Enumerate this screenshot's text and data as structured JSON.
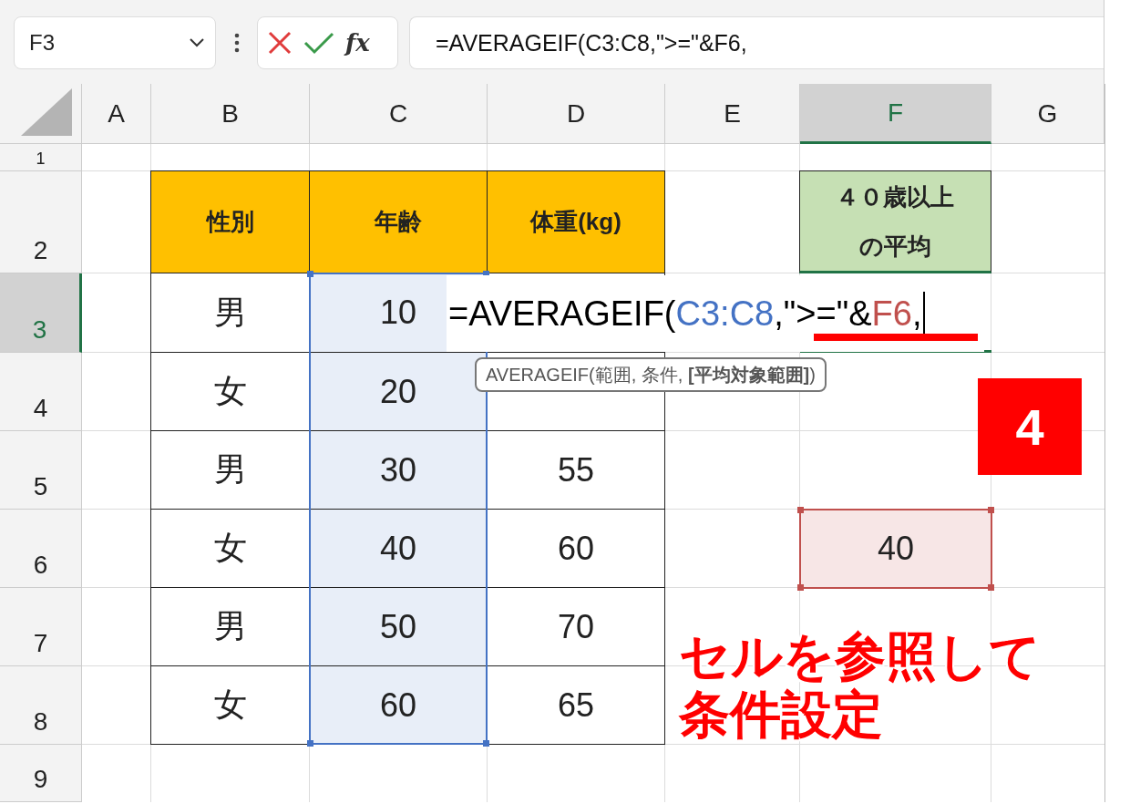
{
  "formula_bar": {
    "name_box": "F3",
    "fx_label": "fx",
    "formula": "=AVERAGEIF(C3:C8,\">=\"&F6,"
  },
  "columns": [
    {
      "label": "A",
      "selected": false
    },
    {
      "label": "B",
      "selected": false
    },
    {
      "label": "C",
      "selected": false
    },
    {
      "label": "D",
      "selected": false
    },
    {
      "label": "E",
      "selected": false
    },
    {
      "label": "F",
      "selected": true
    },
    {
      "label": "G",
      "selected": false
    }
  ],
  "rows": [
    {
      "label": "1",
      "selected": false,
      "cells": [
        {
          "kind": "empty"
        },
        {
          "kind": "empty"
        },
        {
          "kind": "empty"
        },
        {
          "kind": "empty"
        },
        {
          "kind": "empty"
        },
        {
          "kind": "empty"
        },
        {
          "kind": "empty"
        }
      ]
    },
    {
      "label": "2",
      "selected": false,
      "cells": [
        {
          "kind": "empty"
        },
        {
          "kind": "header",
          "value": "性別"
        },
        {
          "kind": "header",
          "value": "年齢"
        },
        {
          "kind": "header",
          "value": "体重(kg)"
        },
        {
          "kind": "empty"
        },
        {
          "kind": "label",
          "value": "４０歳以上の平均"
        },
        {
          "kind": "empty"
        }
      ]
    },
    {
      "label": "3",
      "selected": true,
      "cells": [
        {
          "kind": "empty"
        },
        {
          "kind": "data",
          "value": "男"
        },
        {
          "kind": "range",
          "value": "10"
        },
        {
          "kind": "data"
        },
        {
          "kind": "empty"
        },
        {
          "kind": "active"
        },
        {
          "kind": "empty"
        }
      ]
    },
    {
      "label": "4",
      "selected": false,
      "cells": [
        {
          "kind": "empty"
        },
        {
          "kind": "data",
          "value": "女"
        },
        {
          "kind": "range",
          "value": "20"
        },
        {
          "kind": "data"
        },
        {
          "kind": "empty"
        },
        {
          "kind": "empty"
        },
        {
          "kind": "empty"
        }
      ]
    },
    {
      "label": "5",
      "selected": false,
      "cells": [
        {
          "kind": "empty"
        },
        {
          "kind": "data",
          "value": "男"
        },
        {
          "kind": "range",
          "value": "30"
        },
        {
          "kind": "data",
          "value": "55"
        },
        {
          "kind": "empty"
        },
        {
          "kind": "empty"
        },
        {
          "kind": "empty"
        }
      ]
    },
    {
      "label": "6",
      "selected": false,
      "cells": [
        {
          "kind": "empty"
        },
        {
          "kind": "data",
          "value": "女"
        },
        {
          "kind": "range",
          "value": "40"
        },
        {
          "kind": "data",
          "value": "60"
        },
        {
          "kind": "empty"
        },
        {
          "kind": "ref",
          "value": "40"
        },
        {
          "kind": "empty"
        }
      ]
    },
    {
      "label": "7",
      "selected": false,
      "cells": [
        {
          "kind": "empty"
        },
        {
          "kind": "data",
          "value": "男"
        },
        {
          "kind": "range",
          "value": "50"
        },
        {
          "kind": "data",
          "value": "70"
        },
        {
          "kind": "empty"
        },
        {
          "kind": "empty"
        },
        {
          "kind": "empty"
        }
      ]
    },
    {
      "label": "8",
      "selected": false,
      "cells": [
        {
          "kind": "empty"
        },
        {
          "kind": "data",
          "value": "女"
        },
        {
          "kind": "range",
          "value": "60"
        },
        {
          "kind": "data",
          "value": "65"
        },
        {
          "kind": "empty"
        },
        {
          "kind": "empty"
        },
        {
          "kind": "empty"
        }
      ]
    },
    {
      "label": "9",
      "selected": false,
      "cells": [
        {
          "kind": "empty"
        },
        {
          "kind": "empty"
        },
        {
          "kind": "empty"
        },
        {
          "kind": "empty"
        },
        {
          "kind": "empty"
        },
        {
          "kind": "empty"
        },
        {
          "kind": "empty"
        }
      ]
    }
  ],
  "editing_cell": {
    "parts": [
      {
        "text": "=AVERAGEIF(",
        "color": "#000000"
      },
      {
        "text": "C3:C8",
        "color": "#4472c4"
      },
      {
        "text": ",\">=\"&",
        "color": "#000000"
      },
      {
        "text": "F6",
        "color": "#c0504d"
      },
      {
        "text": ",",
        "color": "#000000"
      }
    ]
  },
  "tooltip": "AVERAGEIF(範囲, 条件, **[平均対象範囲]**)",
  "step_badge": "4",
  "callout": "セルを参照して条件設定"
}
